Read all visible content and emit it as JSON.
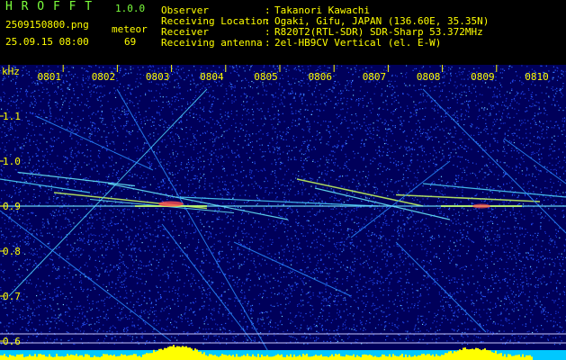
{
  "app": {
    "name": "H R O F F T",
    "version": "1.0.0"
  },
  "file": {
    "name": "2509150800.png",
    "datetime": "25.09.15 08:00"
  },
  "counter": {
    "label": "meteor",
    "value": "69"
  },
  "info": {
    "labels": [
      "Observer",
      "Receiving Location",
      "Receiver",
      "Receiving antenna"
    ],
    "separator": ":",
    "values": [
      "Takanori Kawachi",
      "Ogaki, Gifu, JAPAN (136.60E, 35.35N)",
      "R820T2(RTL-SDR) SDR-Sharp 53.372MHz",
      "2el-HB9CV Vertical (el. E-W)"
    ]
  },
  "spectrogram": {
    "y_unit": "kHz",
    "y_ticks": [
      "1.1",
      "1.0",
      "0.9",
      "0.8",
      "0.7",
      "0.6"
    ],
    "y_range": [
      0.57,
      1.16
    ],
    "x_ticks": [
      "0801",
      "0802",
      "0803",
      "0804",
      "0805",
      "0806",
      "0807",
      "0808",
      "0809",
      "0810"
    ],
    "colors": {
      "background": "#00005a",
      "noise": "#1e40ff",
      "text": "#ffff00",
      "histogram": "#ffff00",
      "baseline": "#00d0ff"
    }
  }
}
